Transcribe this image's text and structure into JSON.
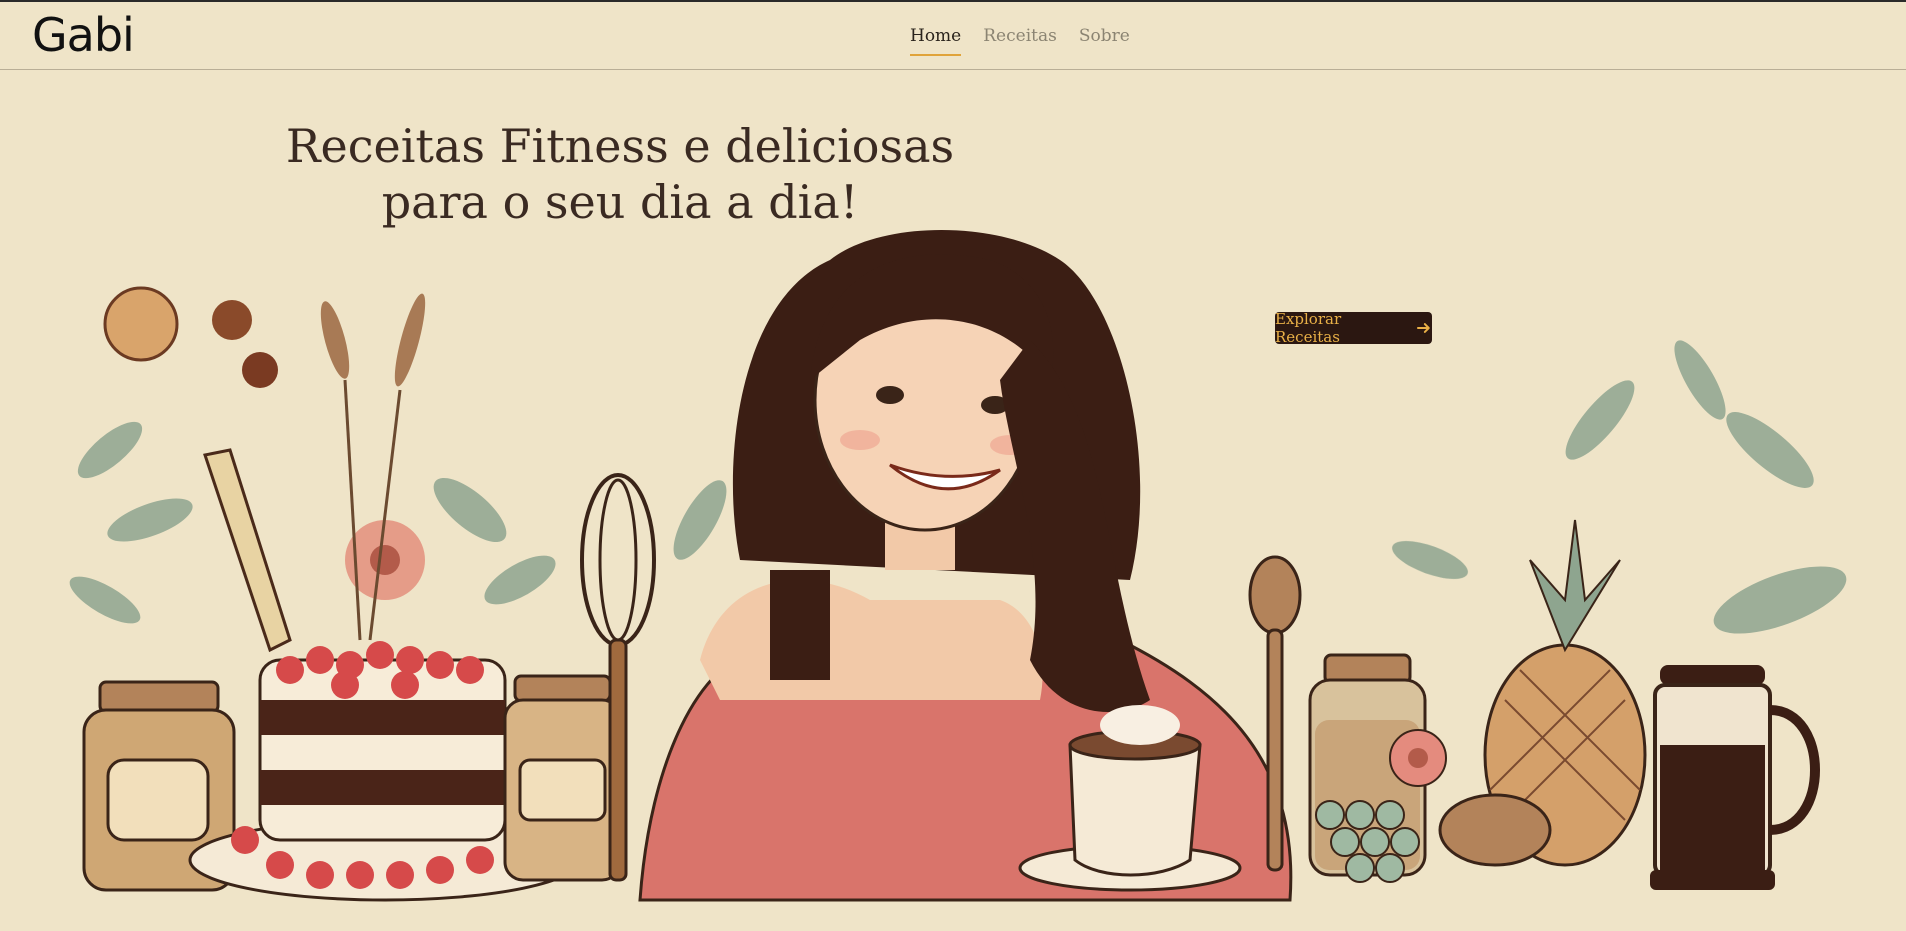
{
  "navbar": {
    "brand": "Gabi",
    "items": [
      {
        "label": "Home",
        "active": true
      },
      {
        "label": "Receitas",
        "active": false
      },
      {
        "label": "Sobre",
        "active": false
      }
    ]
  },
  "hero": {
    "title_line1": "Receitas Fitness e deliciosas",
    "title_line2": "para o seu dia a dia!",
    "cta_label": "Explorar Receitas",
    "cta_icon": "arrow-right-icon"
  },
  "colors": {
    "background": "#efe4c8",
    "accent": "#e0a33a",
    "button_bg": "#2b1711",
    "button_text": "#e9b047"
  }
}
